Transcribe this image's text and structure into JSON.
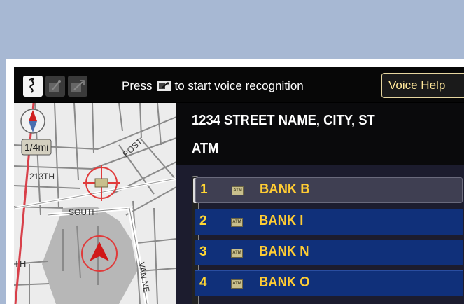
{
  "topbar": {
    "modes": [
      {
        "icon": "map-mode-icon",
        "active": true
      },
      {
        "icon": "route-mode-icon",
        "active": false
      },
      {
        "icon": "voice-mode-icon",
        "active": false
      }
    ],
    "status_prefix": "Press",
    "status_suffix": "to start voice recognition",
    "talk_icon": "talk-button-icon",
    "voice_help_label": "Voice Help"
  },
  "map": {
    "scale_label": "1/4mi",
    "street_labels": {
      "st213": "213TH",
      "post": "POST",
      "south": "SOUTH",
      "th": "TH",
      "van": "VAN NE"
    },
    "compass_icon": "compass-icon",
    "destination_icon": "destination-crosshair-icon",
    "vehicle_icon": "vehicle-position-icon"
  },
  "info": {
    "address": "1234 STREET NAME, CITY, ST",
    "category": "ATM",
    "results": [
      {
        "num": "1",
        "name": "BANK B",
        "icon_text": "ATM",
        "selected": true
      },
      {
        "num": "2",
        "name": "BANK I",
        "icon_text": "ATM",
        "selected": false
      },
      {
        "num": "3",
        "name": "BANK N",
        "icon_text": "ATM",
        "selected": false
      },
      {
        "num": "4",
        "name": "BANK O",
        "icon_text": "ATM",
        "selected": false
      }
    ]
  },
  "colors": {
    "background": "#a7b8d3",
    "list_row": "#10307a",
    "item_text": "#ffcc33",
    "map_bg": "#ececec"
  }
}
